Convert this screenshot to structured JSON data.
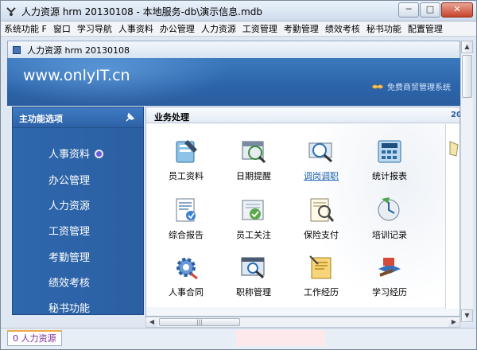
{
  "window": {
    "title": "人力资源 hrm 20130108 - 本地服务-db\\演示信息.mdb",
    "buttons": {
      "minimize": "─",
      "maximize": "□",
      "close": "✕"
    }
  },
  "menu": [
    "系统功能 F",
    "窗口",
    "学习导航",
    "人事资料",
    "办公管理",
    "人力资源",
    "工资管理",
    "考勤管理",
    "绩效考核",
    "秘书功能",
    "配置管理"
  ],
  "inner_window": {
    "title": "人力资源 hrm 20130108"
  },
  "banner": {
    "url": "www.onlyIT.cn",
    "right_text": "免费商贸管理系统"
  },
  "sidebar": {
    "title": "主功能选项",
    "items": [
      "人事资料",
      "办公管理",
      "人力资源",
      "工资管理",
      "考勤管理",
      "绩效考核",
      "秘书功能"
    ]
  },
  "content": {
    "title": "业务处理",
    "year_fragment": "20",
    "cells": [
      {
        "label": "员工资料",
        "icon": "employee-file-icon"
      },
      {
        "label": "日期提醒",
        "icon": "date-reminder-icon"
      },
      {
        "label": "调岗调职",
        "icon": "transfer-icon"
      },
      {
        "label": "统计报表",
        "icon": "calculator-icon"
      },
      {
        "label": "综合报告",
        "icon": "report-icon"
      },
      {
        "label": "员工关注",
        "icon": "employee-care-icon"
      },
      {
        "label": "保险支付",
        "icon": "insurance-icon"
      },
      {
        "label": "培训记录",
        "icon": "training-icon"
      },
      {
        "label": "人事合同",
        "icon": "contract-gear-icon"
      },
      {
        "label": "职称管理",
        "icon": "title-manage-icon"
      },
      {
        "label": "工作经历",
        "icon": "work-history-icon"
      },
      {
        "label": "学习经历",
        "icon": "study-history-icon"
      }
    ]
  },
  "scrollbar": {
    "up": "▲",
    "down": "▼",
    "left": "◀",
    "right": "▶",
    "grip": "|||"
  },
  "status": {
    "tab_label": "0 人力资源"
  },
  "colors": {
    "banner": "#2f6aaf",
    "sidebar": "#2d62a6",
    "link": "#1b5fae",
    "status_tab_text": "#7a2c9a"
  }
}
